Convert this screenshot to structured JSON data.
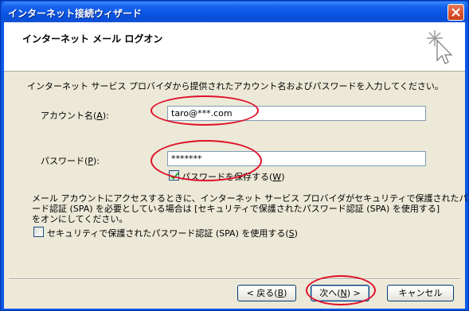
{
  "window": {
    "title": "インターネット接続ウィザード"
  },
  "header": {
    "title": "インターネット メール ログオン"
  },
  "intro_text": "インターネット サービス プロバイダから提供されたアカウント名およびパスワードを入力してください。",
  "account": {
    "label_prefix": "アカウント名(",
    "label_key": "A",
    "label_suffix": "):",
    "value": "taro@***.com"
  },
  "password": {
    "label_prefix": "パスワード(",
    "label_key": "P",
    "label_suffix": "):",
    "value": "*******"
  },
  "save_password": {
    "label_prefix": "パスワードを保存する(",
    "label_key": "W",
    "label_suffix": ")",
    "checked": true
  },
  "spa_note": {
    "line1": "メール アカウントにアクセスするときに、インターネット サービス プロバイダがセキュリティで保護されたパスワ",
    "line2": "ード認証 (SPA) を必要としている場合は [セキュリティで保護されたパスワード認証 (SPA) を使用する]",
    "line3": "をオンにしてください。"
  },
  "spa_checkbox": {
    "label_prefix": "セキュリティで保護されたパスワード認証 (SPA) を使用する(",
    "label_key": "S",
    "label_suffix": ")",
    "checked": false
  },
  "buttons": {
    "back": {
      "prefix": "< 戻る(",
      "key": "B",
      "suffix": ")"
    },
    "next": {
      "prefix": "次へ(",
      "key": "N",
      "suffix": ") >"
    },
    "cancel": "キャンセル"
  },
  "colors": {
    "titlebar": "#0b56e5",
    "dialog_bg": "#ece9d8",
    "annotation_oval": "#e0102a"
  },
  "icons": {
    "title_close": "close-icon",
    "header": "wizard-sparkle-cursor-icon"
  }
}
